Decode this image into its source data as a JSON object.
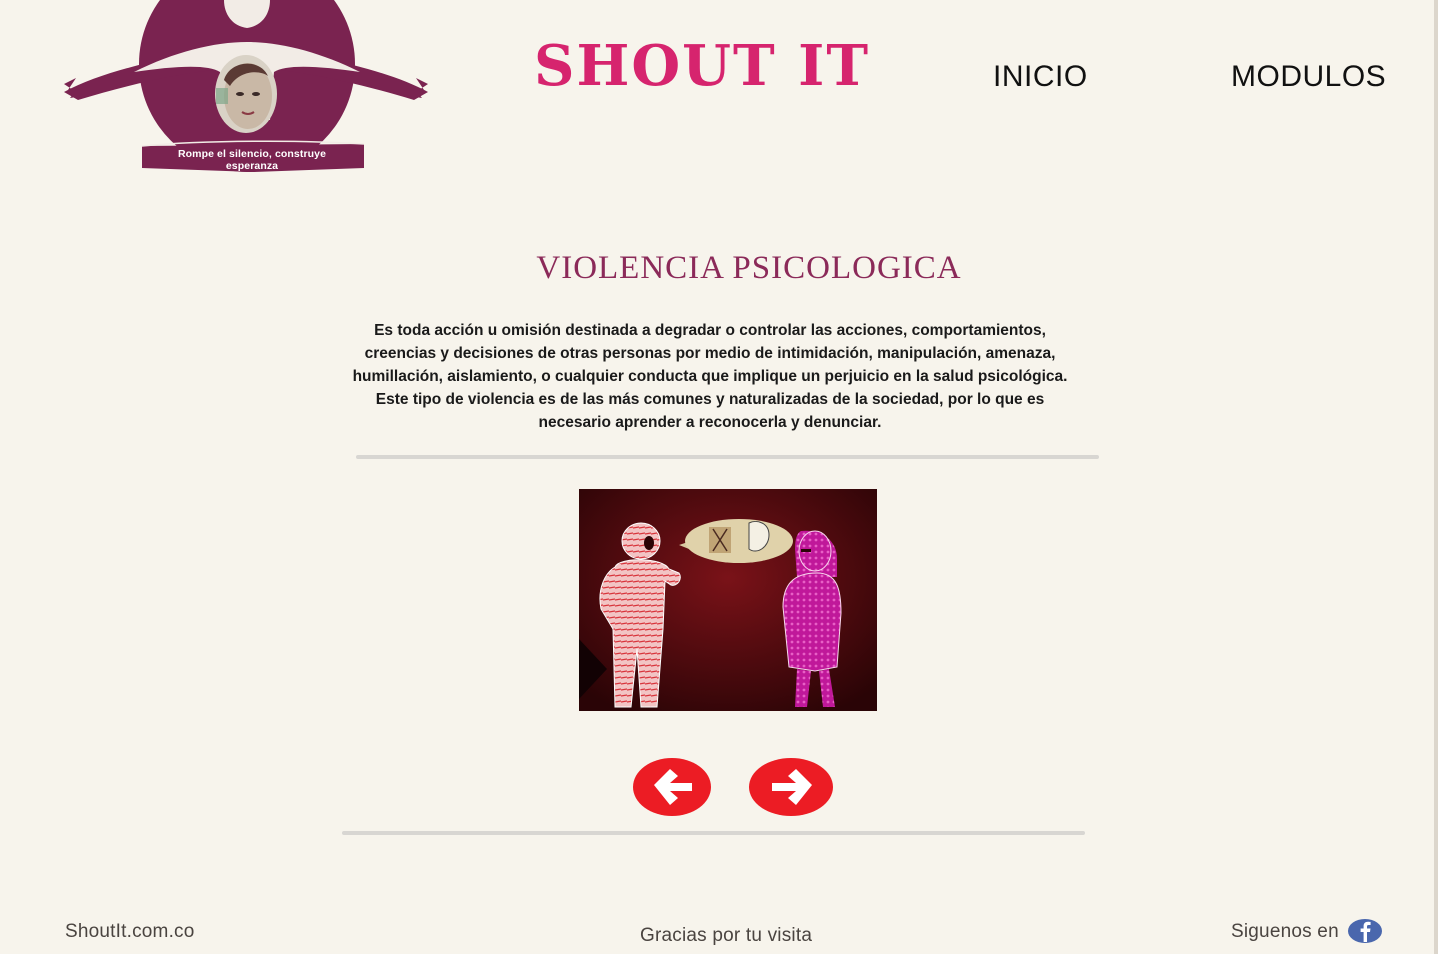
{
  "logo": {
    "tagline": "Rompe el silencio, construye esperanza",
    "colors": {
      "circle": "#7a2350",
      "figure": "#f2ece6"
    }
  },
  "header": {
    "title": "SHOUT IT",
    "title_color": "#d6246e",
    "nav": [
      {
        "label": "INICIO"
      },
      {
        "label": "MODULOS"
      }
    ]
  },
  "main": {
    "heading": "VIOLENCIA PSICOLOGICA",
    "heading_color": "#8b2a59",
    "description": "Es toda acción u omisión destinada a degradar o controlar las acciones, comportamientos, creencias y decisiones de otras personas por medio de intimidación, manipulación, amenaza, humillación, aislamiento, o cualquier conducta que implique un perjuicio en la salud psicológica. Este tipo de violencia es de las más comunes y naturalizadas de la sociedad, por lo que es necesario aprender a reconocerla y denunciar.",
    "illustration_icon": "psychological-violence-illustration",
    "arrows": {
      "previous_icon": "arrow-left-icon",
      "next_icon": "arrow-right-icon",
      "color": "#ec1c24"
    }
  },
  "footer": {
    "site": "ShoutIt.com.co",
    "thanks": "Gracias por tu visita",
    "follow": "Siguenos en",
    "social_icon": "facebook-icon",
    "social_color": "#4a67ad"
  }
}
